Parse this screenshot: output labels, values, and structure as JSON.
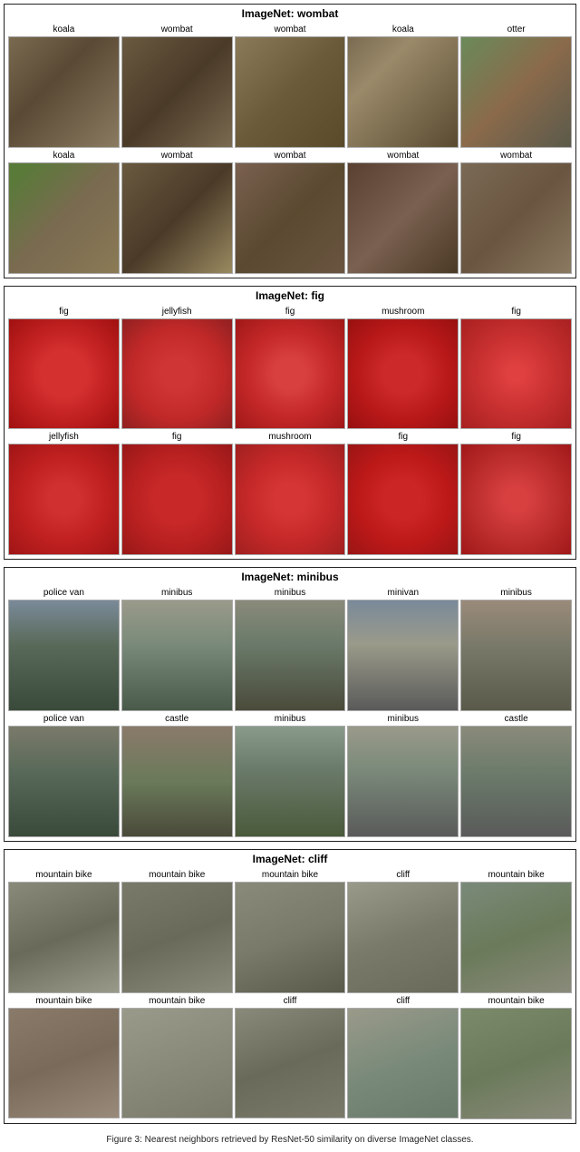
{
  "sections": [
    {
      "id": "wombat",
      "title": "ImageNet: wombat",
      "rows": [
        [
          {
            "label": "koala",
            "imgClass": "wombat-1"
          },
          {
            "label": "wombat",
            "imgClass": "wombat-2"
          },
          {
            "label": "wombat",
            "imgClass": "wombat-3"
          },
          {
            "label": "koala",
            "imgClass": "wombat-4"
          },
          {
            "label": "otter",
            "imgClass": "wombat-5"
          }
        ],
        [
          {
            "label": "koala",
            "imgClass": "wombat-6"
          },
          {
            "label": "wombat",
            "imgClass": "wombat-7"
          },
          {
            "label": "wombat",
            "imgClass": "wombat-8"
          },
          {
            "label": "wombat",
            "imgClass": "wombat-9"
          },
          {
            "label": "wombat",
            "imgClass": "wombat-10"
          }
        ]
      ]
    },
    {
      "id": "fig",
      "title": "ImageNet: fig",
      "rows": [
        [
          {
            "label": "fig",
            "imgClass": "fig-1"
          },
          {
            "label": "jellyfish",
            "imgClass": "fig-2"
          },
          {
            "label": "fig",
            "imgClass": "fig-3"
          },
          {
            "label": "mushroom",
            "imgClass": "fig-4"
          },
          {
            "label": "fig",
            "imgClass": "fig-5"
          }
        ],
        [
          {
            "label": "jellyfish",
            "imgClass": "fig-6"
          },
          {
            "label": "fig",
            "imgClass": "fig-7"
          },
          {
            "label": "mushroom",
            "imgClass": "fig-8"
          },
          {
            "label": "fig",
            "imgClass": "fig-9"
          },
          {
            "label": "fig",
            "imgClass": "fig-10"
          }
        ]
      ]
    },
    {
      "id": "minibus",
      "title": "ImageNet: minibus",
      "rows": [
        [
          {
            "label": "police van",
            "imgClass": "mini-1"
          },
          {
            "label": "minibus",
            "imgClass": "mini-2"
          },
          {
            "label": "minibus",
            "imgClass": "mini-3"
          },
          {
            "label": "minivan",
            "imgClass": "mini-4"
          },
          {
            "label": "minibus",
            "imgClass": "mini-5"
          }
        ],
        [
          {
            "label": "police van",
            "imgClass": "mini-6"
          },
          {
            "label": "castle",
            "imgClass": "mini-7"
          },
          {
            "label": "minibus",
            "imgClass": "mini-8"
          },
          {
            "label": "minibus",
            "imgClass": "mini-9"
          },
          {
            "label": "castle",
            "imgClass": "mini-10"
          }
        ]
      ]
    },
    {
      "id": "cliff",
      "title": "ImageNet: cliff",
      "rows": [
        [
          {
            "label": "mountain bike",
            "imgClass": "cliff-1"
          },
          {
            "label": "mountain bike",
            "imgClass": "cliff-2"
          },
          {
            "label": "mountain bike",
            "imgClass": "cliff-3"
          },
          {
            "label": "cliff",
            "imgClass": "cliff-4"
          },
          {
            "label": "mountain bike",
            "imgClass": "cliff-5"
          }
        ],
        [
          {
            "label": "mountain bike",
            "imgClass": "cliff-6"
          },
          {
            "label": "mountain bike",
            "imgClass": "cliff-7"
          },
          {
            "label": "cliff",
            "imgClass": "cliff-8"
          },
          {
            "label": "cliff",
            "imgClass": "cliff-9"
          },
          {
            "label": "mountain bike",
            "imgClass": "cliff-10"
          }
        ]
      ]
    }
  ],
  "footer": "Figure 3: Nearest neighbors retrieved by ResNet-50 similarity on diverse ImageNet classes."
}
